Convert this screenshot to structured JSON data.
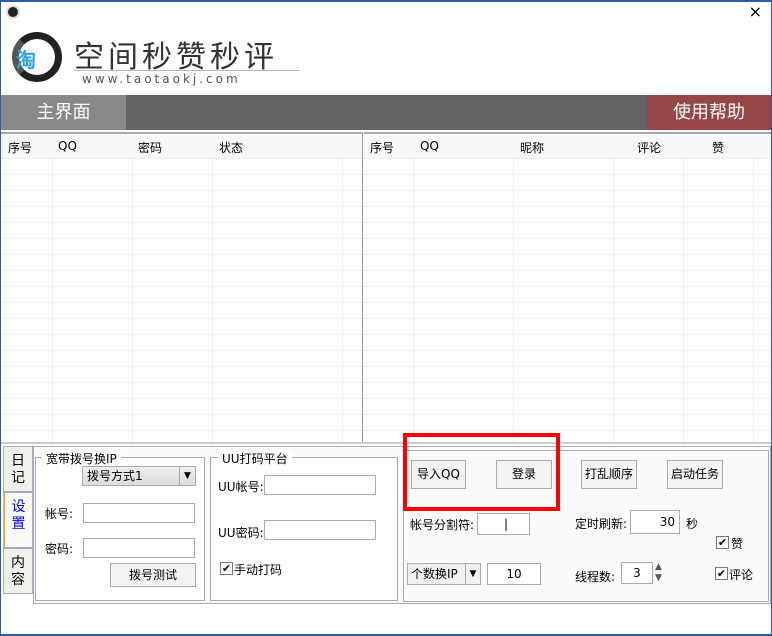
{
  "window": {
    "close": "×"
  },
  "logo": {
    "mark": "淘",
    "title": "空间秒赞秒评",
    "url": "www.taotaokj.com"
  },
  "nav": {
    "main": "主界面",
    "help": "使用帮助"
  },
  "left_table": {
    "columns": [
      "序号",
      "QQ",
      "密码",
      "状态"
    ]
  },
  "right_table": {
    "columns": [
      "序号",
      "QQ",
      "昵称",
      "评论",
      "赞"
    ]
  },
  "side_tabs": [
    "日记",
    "设置",
    "内容"
  ],
  "broadband": {
    "title": "宽带拨号换IP",
    "dial_mode": "拨号方式1",
    "account_label": "帐号:",
    "password_label": "密码:",
    "test_button": "拨号测试"
  },
  "uu": {
    "title": "UU打码平台",
    "account_label": "UU帐号:",
    "password_label": "UU密码:",
    "manual_label": "手动打码",
    "manual_checked": true
  },
  "actions": {
    "import": "导入QQ",
    "login": "登录",
    "shuffle": "打乱顺序",
    "start": "启动任务"
  },
  "settings": {
    "separator_label": "帐号分割符:",
    "separator_value": "|",
    "refresh_label": "定时刷新:",
    "refresh_value": "30",
    "refresh_unit": "秒",
    "like_label": "赞",
    "like_checked": true,
    "comment_label": "评论",
    "comment_checked": true,
    "ip_mode": "个数换IP",
    "ip_count": "10",
    "threads_label": "线程数:",
    "threads_value": "3"
  },
  "highlight_color": "#ff0000"
}
